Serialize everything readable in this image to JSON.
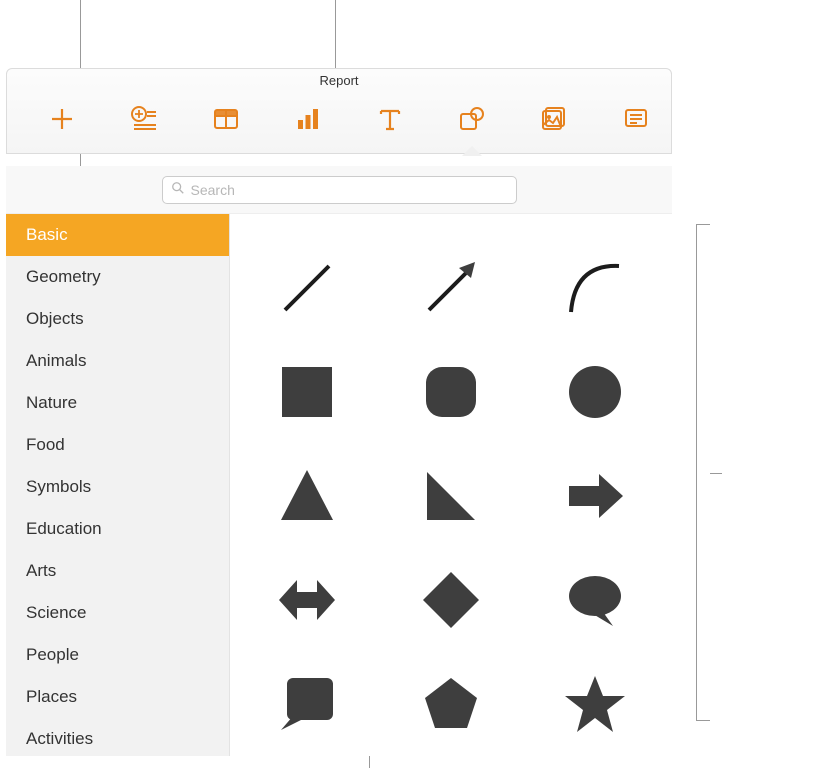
{
  "window": {
    "title": "Report"
  },
  "toolbar": {
    "items": [
      {
        "name": "add-icon"
      },
      {
        "name": "add-list-icon"
      },
      {
        "name": "table-icon"
      },
      {
        "name": "chart-icon"
      },
      {
        "name": "text-icon"
      },
      {
        "name": "shape-icon",
        "active": true
      },
      {
        "name": "media-icon"
      },
      {
        "name": "comment-icon"
      }
    ]
  },
  "search": {
    "placeholder": "Search"
  },
  "categories": [
    "Basic",
    "Geometry",
    "Objects",
    "Animals",
    "Nature",
    "Food",
    "Symbols",
    "Education",
    "Arts",
    "Science",
    "People",
    "Places",
    "Activities"
  ],
  "selected_category_index": 0,
  "shapes": [
    "line",
    "arrow-line",
    "curve",
    "square",
    "rounded-square",
    "circle",
    "triangle",
    "right-triangle",
    "right-arrow",
    "double-arrow",
    "diamond",
    "speech-bubble",
    "callout-left",
    "pentagon",
    "star"
  ],
  "colors": {
    "accent": "#E6821E",
    "selected": "#F5A623",
    "shape": "#3e3e3e"
  }
}
